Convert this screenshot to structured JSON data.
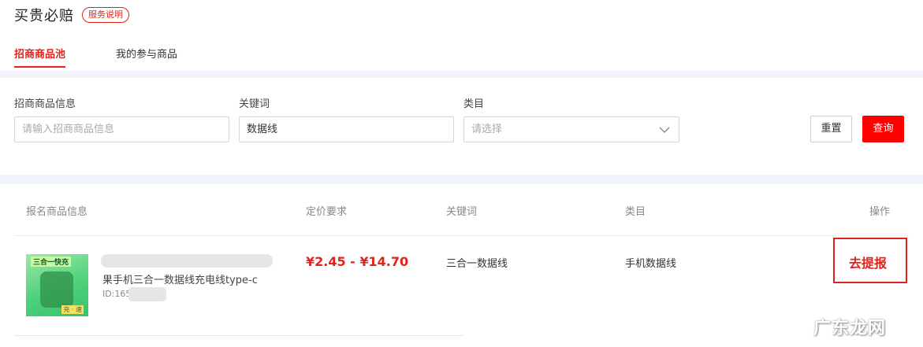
{
  "header": {
    "title": "买贵必赔",
    "service_badge": "服务说明"
  },
  "tabs": [
    {
      "label": "招商商品池",
      "active": true
    },
    {
      "label": "我的参与商品",
      "active": false
    }
  ],
  "filters": {
    "product_info": {
      "label": "招商商品信息",
      "placeholder": "请输入招商商品信息",
      "value": ""
    },
    "keyword": {
      "label": "关键词",
      "value": "数据线"
    },
    "category": {
      "label": "类目",
      "placeholder": "请选择"
    },
    "reset_label": "重置",
    "query_label": "查询"
  },
  "table": {
    "columns": [
      "报名商品信息",
      "定价要求",
      "关键词",
      "类目",
      "操作"
    ],
    "rows": [
      {
        "image_badge": "三合一快充",
        "image_tag": "充 · 速",
        "name": "果手机三合一数据线充电线type-c",
        "id_text": "ID:165",
        "price": "¥2.45 - ¥14.70",
        "keyword": "三合一数据线",
        "category": "手机数据线",
        "action": "去提报"
      }
    ]
  },
  "watermark": "广东龙网",
  "colors": {
    "accent": "#e2231a",
    "query_button": "#ff0000",
    "band": "#f0f3fa"
  }
}
